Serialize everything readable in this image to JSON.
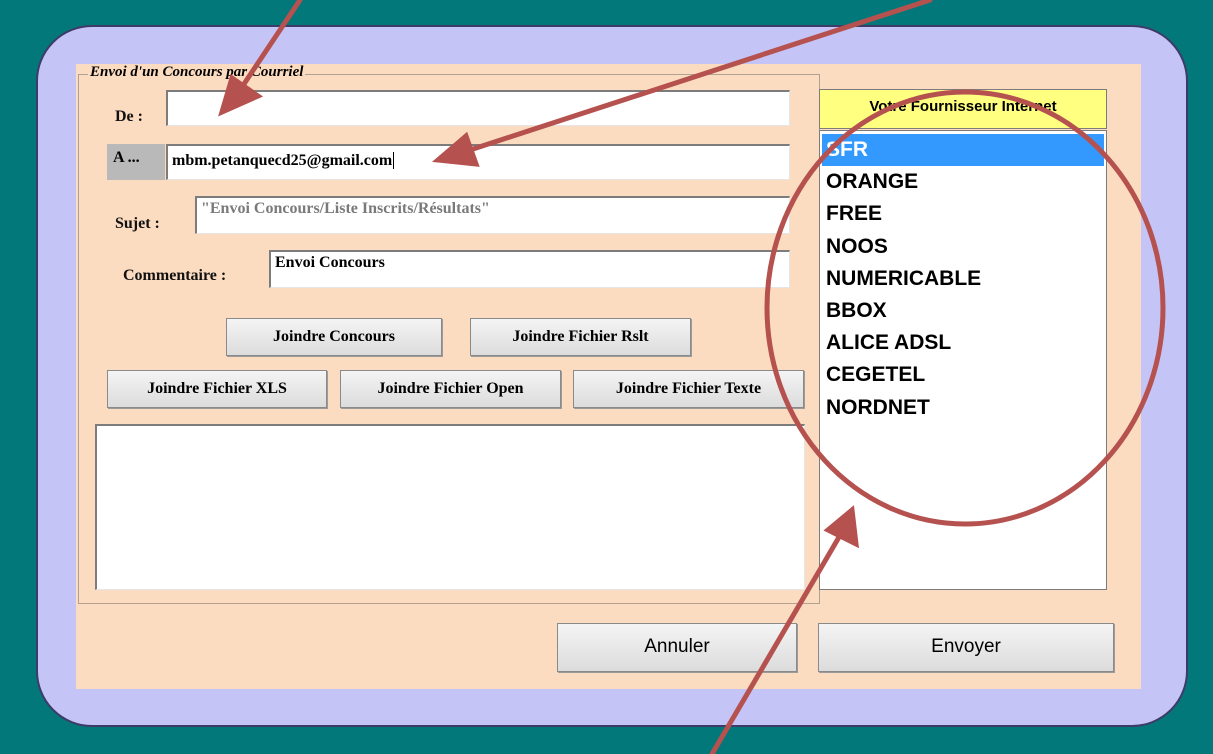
{
  "dialog": {
    "group_title": "Envoi d'un Concours par Courriel",
    "from_label": "De :",
    "from_value": "",
    "to_button": "A ...",
    "to_value": "mbm.petanquecd25@gmail.com",
    "subject_label": "Sujet :",
    "subject_value": "\"Envoi Concours/Liste Inscrits/Résultats\"",
    "comment_label": "Commentaire :",
    "comment_value": "Envoi Concours",
    "attach_buttons": {
      "concours": "Joindre Concours",
      "rslt": "Joindre Fichier Rslt",
      "xls": "Joindre Fichier XLS",
      "open": "Joindre Fichier Open",
      "texte": "Joindre Fichier Texte"
    },
    "cancel": "Annuler",
    "send": "Envoyer"
  },
  "isp": {
    "header": "Votre Fournisseur Internet",
    "items": [
      "SFR",
      "ORANGE",
      "FREE",
      "NOOS",
      "NUMERICABLE",
      "BBOX",
      "ALICE ADSL",
      "CEGETEL",
      "NORDNET"
    ],
    "selected": "SFR"
  },
  "colors": {
    "background": "#03787a",
    "frame": "#c5c4f7",
    "panel": "#fcdcc1",
    "header_yellow": "#ffff80",
    "selection": "#3399ff",
    "annotation": "#b5524f"
  }
}
